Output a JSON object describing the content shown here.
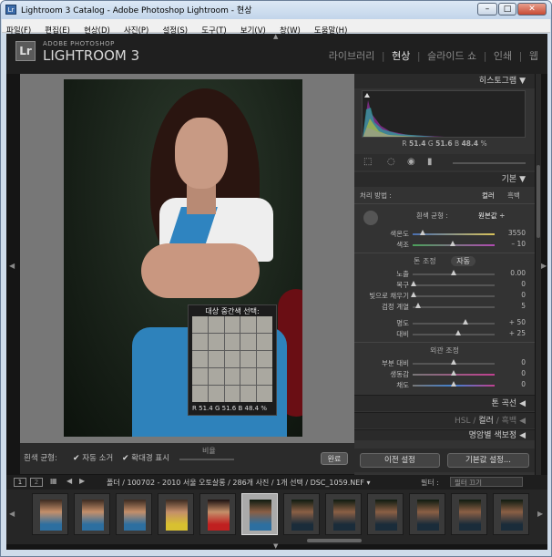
{
  "window": {
    "title": "Lightroom 3 Catalog - Adobe Photoshop Lightroom - 현상",
    "app_icon": "Lr",
    "min": "–",
    "max": "□",
    "close": "✕"
  },
  "menu": [
    "파일(F)",
    "편집(E)",
    "현상(D)",
    "사진(P)",
    "설정(S)",
    "도구(T)",
    "보기(V)",
    "창(W)",
    "도움말(H)"
  ],
  "brand": {
    "line1": "ADOBE PHOTOSHOP",
    "line2": "LIGHTROOM 3",
    "logo": "Lr"
  },
  "modules": {
    "library": "라이브러리",
    "develop": "현상",
    "slideshow": "슬라이드 쇼",
    "print": "인쇄",
    "web": "웹",
    "sep": "|"
  },
  "loupe": {
    "picker_title": "대상 중간색 선택:",
    "r_label": "R",
    "r": "51.4",
    "g_label": "G",
    "g": "51.6",
    "b_label": "B",
    "b": "48.4",
    "unit": "%"
  },
  "toolbar": {
    "wb_label": "흰색 균형:",
    "auto_dismiss": "자동 소거",
    "show_loupe": "확대경 표시",
    "scale_label": "비율",
    "done": "완료",
    "checkmark": "✔"
  },
  "histogram": {
    "title": "히스토그램",
    "r_label": "R",
    "r": "51.4",
    "g_label": "G",
    "g": "51.6",
    "b_label": "B",
    "b": "48.4",
    "unit": "%"
  },
  "basic": {
    "title": "기본",
    "treatment_label": "처리 방법 :",
    "color": "컬러",
    "bw": "흑백",
    "wb_label": "흰색 균형 :",
    "wb_value": "원본값 ÷",
    "temp": {
      "label": "색온도",
      "value": "3550"
    },
    "tint": {
      "label": "색조",
      "value": "– 10"
    },
    "tone_label": "톤 조정",
    "auto": "자동",
    "exposure": {
      "label": "노출",
      "value": "0.00"
    },
    "recovery": {
      "label": "복구",
      "value": "0"
    },
    "fill": {
      "label": "빛으로 채우기",
      "value": "0"
    },
    "blacks": {
      "label": "검정 계열",
      "value": "5"
    },
    "brightness": {
      "label": "명도",
      "value": "+ 50"
    },
    "contrast": {
      "label": "대비",
      "value": "+ 25"
    },
    "presence_label": "외관 조정",
    "clarity": {
      "label": "부분 대비",
      "value": "0"
    },
    "vibrance": {
      "label": "생동감",
      "value": "0"
    },
    "saturation": {
      "label": "채도",
      "value": "0"
    }
  },
  "collapsed": {
    "tone_curve": "톤 곡선",
    "hsl": "HSL",
    "color_tab": "컬러",
    "bw_tab": "흑백",
    "split": "명암별 색보정",
    "sep": "/",
    "arrow": "◀"
  },
  "buttons": {
    "previous": "이전 설정",
    "reset": "기본값 설정..."
  },
  "filmstrip": {
    "page1": "1",
    "page2": "2",
    "path": "폴더 / 100702 - 2010 서울 오토살롱 / 286개 사진 / 1개 선택 / DSC_1059.NEF ▾",
    "filter_label": "필터 :",
    "filter_value": "필터 끄기"
  },
  "colors": {
    "accent": "#e6e6e6",
    "panel": "#333333",
    "background": "#151515"
  }
}
